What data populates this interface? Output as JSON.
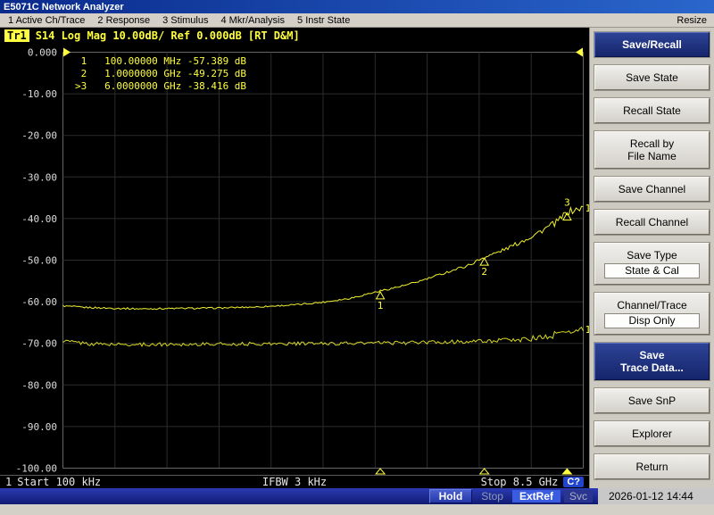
{
  "window": {
    "title": "E5071C Network Analyzer",
    "resize": "Resize"
  },
  "menu": {
    "items": [
      "1 Active Ch/Trace",
      "2 Response",
      "3 Stimulus",
      "4 Mkr/Analysis",
      "5 Instr State"
    ]
  },
  "trace_header": {
    "badge": "Tr1",
    "text": "S14 Log Mag 10.00dB/ Ref 0.000dB",
    "status": "[RT D&M]"
  },
  "markers": [
    {
      "num": "1",
      "freq": "100.00000 MHz",
      "value": "-57.389 dB",
      "active": false,
      "t": 0.61,
      "db": -57.389,
      "label_pos": "below"
    },
    {
      "num": "2",
      "freq": "1.0000000 GHz",
      "value": "-49.275 dB",
      "active": false,
      "t": 0.81,
      "db": -49.275,
      "label_pos": "below"
    },
    {
      "num": "3",
      "freq": "6.0000000 GHz",
      "value": "-38.416 dB",
      "active": true,
      "t": 0.969,
      "db": -38.416,
      "label_pos": "above"
    }
  ],
  "axis": {
    "y_labels": [
      "0.000",
      "-10.00",
      "-20.00",
      "-30.00",
      "-40.00",
      "-50.00",
      "-60.00",
      "-70.00",
      "-80.00",
      "-90.00",
      "-100.00"
    ]
  },
  "footer": {
    "channel": "1",
    "start": "Start 100 kHz",
    "ifbw": "IFBW 3 kHz",
    "stop": "Stop 8.5 GHz",
    "cal": "C?"
  },
  "softkeys": {
    "buttons": [
      {
        "lines": [
          "Save/Recall"
        ],
        "style": "title"
      },
      {
        "lines": [
          "Save State"
        ]
      },
      {
        "lines": [
          "Recall State"
        ]
      },
      {
        "lines": [
          "Recall by",
          "File Name"
        ]
      },
      {
        "lines": [
          "Save Channel"
        ]
      },
      {
        "lines": [
          "Recall Channel"
        ]
      },
      {
        "lines": [
          "Save Type"
        ],
        "value": "State & Cal"
      },
      {
        "lines": [
          "Channel/Trace"
        ],
        "value": "Disp Only"
      },
      {
        "lines": [
          "Save",
          "Trace Data..."
        ],
        "style": "dark"
      },
      {
        "lines": [
          "Save SnP"
        ]
      },
      {
        "lines": [
          "Explorer"
        ]
      },
      {
        "lines": [
          "Return"
        ]
      }
    ]
  },
  "statusbar": {
    "hold": "Hold",
    "stop": "Stop",
    "extref": "ExtRef",
    "svc": "Svc",
    "datetime": "2026-01-12 14:44"
  },
  "chart_data": {
    "type": "line",
    "x_axis": {
      "scale": "log",
      "start": "100 kHz",
      "stop": "8.5 GHz"
    },
    "y_axis": {
      "unit": "dB",
      "max": 0,
      "min": -100,
      "divisions": 10,
      "scale_per_div": "10.00dB/",
      "ref": "0.000dB"
    },
    "series": [
      {
        "name": "tr1-data",
        "color": "#f0f030",
        "end_label": "1",
        "points": [
          [
            0,
            -61.0
          ],
          [
            0.03,
            -61.3
          ],
          [
            0.08,
            -61.5
          ],
          [
            0.15,
            -61.7
          ],
          [
            0.22,
            -61.6
          ],
          [
            0.3,
            -61.5
          ],
          [
            0.38,
            -61.2
          ],
          [
            0.45,
            -60.7
          ],
          [
            0.5,
            -60.1
          ],
          [
            0.55,
            -59.2
          ],
          [
            0.61,
            -57.39
          ],
          [
            0.66,
            -56.0
          ],
          [
            0.7,
            -54.5
          ],
          [
            0.74,
            -52.8
          ],
          [
            0.78,
            -51.2
          ],
          [
            0.81,
            -49.28
          ],
          [
            0.84,
            -47.9
          ],
          [
            0.87,
            -46.2
          ],
          [
            0.9,
            -44.3
          ],
          [
            0.93,
            -42.2
          ],
          [
            0.95,
            -40.8
          ],
          [
            0.969,
            -38.42
          ],
          [
            0.98,
            -38.1
          ],
          [
            1,
            -37.4
          ]
        ],
        "noise": [
          [
            0,
            0.22
          ],
          [
            0.4,
            0.18
          ],
          [
            0.7,
            0.25
          ],
          [
            0.85,
            0.45
          ],
          [
            0.95,
            0.8
          ],
          [
            1,
            0.9
          ]
        ]
      },
      {
        "name": "tr1-memory",
        "color": "#d8d828",
        "end_label": "1",
        "points": [
          [
            0,
            -69.4
          ],
          [
            0.05,
            -70.1
          ],
          [
            0.12,
            -70.3
          ],
          [
            0.25,
            -70.2
          ],
          [
            0.4,
            -70.1
          ],
          [
            0.55,
            -70.0
          ],
          [
            0.7,
            -69.8
          ],
          [
            0.8,
            -69.5
          ],
          [
            0.88,
            -69.1
          ],
          [
            0.93,
            -68.5
          ],
          [
            0.97,
            -67.2
          ],
          [
            1,
            -66.6
          ]
        ],
        "noise": [
          [
            0,
            0.45
          ],
          [
            0.5,
            0.4
          ],
          [
            0.85,
            0.5
          ],
          [
            0.95,
            0.9
          ],
          [
            1,
            0.8
          ]
        ]
      }
    ]
  }
}
